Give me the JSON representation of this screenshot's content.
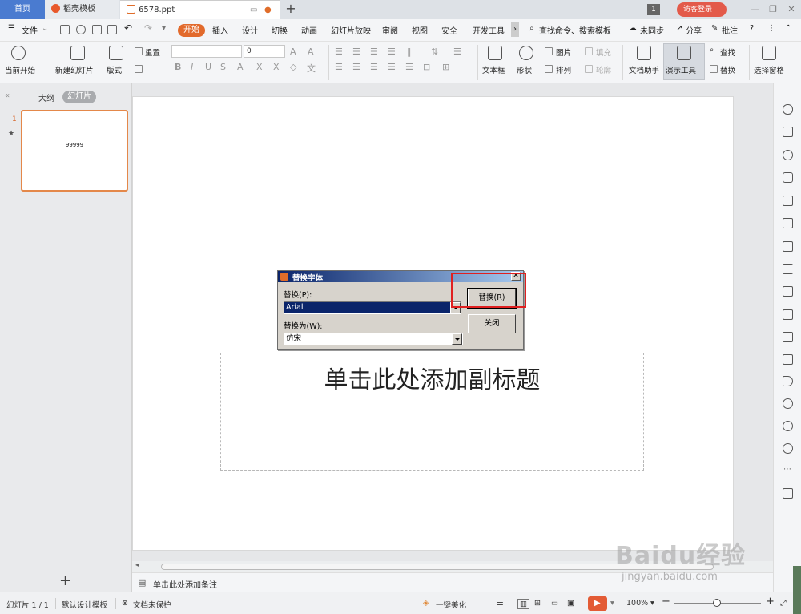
{
  "tabs": {
    "home": "首页",
    "template": "稻壳模板",
    "file": "6578.ppt"
  },
  "topright": {
    "badge": "1",
    "login": "访客登录"
  },
  "menu": {
    "file": "文件",
    "start": "开始",
    "items": [
      "插入",
      "设计",
      "切换",
      "动画",
      "幻灯片放映",
      "审阅",
      "视图",
      "安全",
      "开发工具"
    ],
    "search": "查找命令、搜索模板",
    "sync": "未同步",
    "share": "分享",
    "comment": "批注"
  },
  "ribbon": {
    "from_current": "当前开始",
    "new_slide": "新建幻灯片",
    "layout": "版式",
    "reset": "重置",
    "font_name": "",
    "font_size": "0",
    "textbox": "文本框",
    "shape": "形状",
    "picture": "图片",
    "arrange": "排列",
    "fill": "填充",
    "outline": "轮廓",
    "doc_helper": "文档助手",
    "present_tools": "演示工具",
    "find": "查找",
    "replace": "替换",
    "select_pane": "选择窗格"
  },
  "leftpane": {
    "outline_tab": "大纲",
    "slides_tab": "幻灯片",
    "slide_number": "1",
    "thumb_text": "99999"
  },
  "slide": {
    "subtitle_placeholder": "单击此处添加副标题"
  },
  "notes": {
    "placeholder": "单击此处添加备注"
  },
  "dialog": {
    "title": "替换字体",
    "replace_label": "替换(P):",
    "replace_value": "Arial",
    "with_label": "替换为(W):",
    "with_value": "仿宋",
    "replace_button": "替换(R)",
    "close_button": "关闭",
    "close_x": "✕"
  },
  "status": {
    "slide_info": "幻灯片 1 / 1",
    "design": "默认设计模板",
    "protect": "文档未保护",
    "beautify": "一键美化",
    "zoom": "100%"
  },
  "watermark": {
    "logo": "Baidu经验",
    "url": "jingyan.baidu.com"
  },
  "colors": {
    "accent": "#e26a2c",
    "home_tab": "#4a7bd0",
    "login": "#e35a4a",
    "highlight": "#e02020"
  }
}
